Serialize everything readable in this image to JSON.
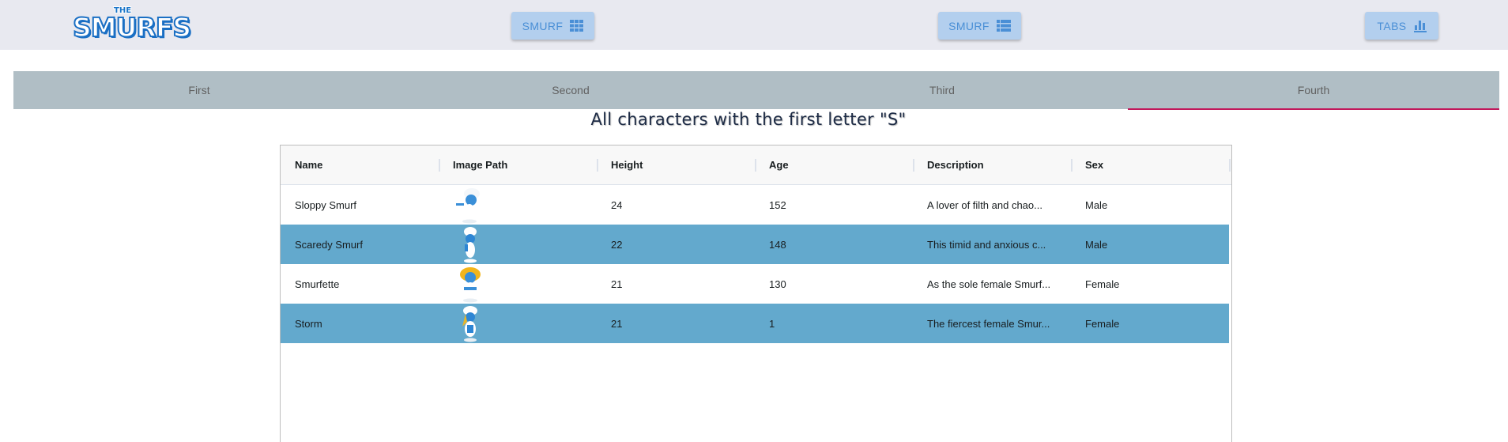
{
  "header": {
    "logo_top": "THE",
    "logo_main": "SMURFS",
    "buttons": [
      {
        "label": "SMURF",
        "icon": "grid-icon"
      },
      {
        "label": "SMURF",
        "icon": "list-icon"
      },
      {
        "label": "TABS",
        "icon": "bar-chart-icon"
      }
    ]
  },
  "tabs": [
    {
      "label": "First",
      "active": false
    },
    {
      "label": "Second",
      "active": false
    },
    {
      "label": "Third",
      "active": false
    },
    {
      "label": "Fourth",
      "active": true
    }
  ],
  "heading": "All characters with the first letter \"S\"",
  "table": {
    "columns": [
      "Name",
      "Image Path",
      "Height",
      "Age",
      "Description",
      "Sex"
    ],
    "rows": [
      {
        "name": "Sloppy Smurf",
        "image": "smurf-image",
        "height": "24",
        "age": "152",
        "description": "A lover of filth and chao...",
        "sex": "Male"
      },
      {
        "name": "Scaredy Smurf",
        "image": "smurf-image",
        "height": "22",
        "age": "148",
        "description": "This timid and anxious c...",
        "sex": "Male"
      },
      {
        "name": "Smurfette",
        "image": "smurfette-image",
        "height": "21",
        "age": "130",
        "description": "As the sole female Smurf...",
        "sex": "Female"
      },
      {
        "name": "Storm",
        "image": "smurfette-image",
        "height": "21",
        "age": "1",
        "description": "The fiercest female Smur...",
        "sex": "Female"
      }
    ]
  },
  "colors": {
    "topbar": "#e8e9f0",
    "button_bg": "#b3cfee",
    "button_text": "#4a8fd6",
    "tabs_bg": "#b0bec5",
    "active_tab_underline": "#c2185b",
    "highlight_row": "#63a9cd"
  }
}
